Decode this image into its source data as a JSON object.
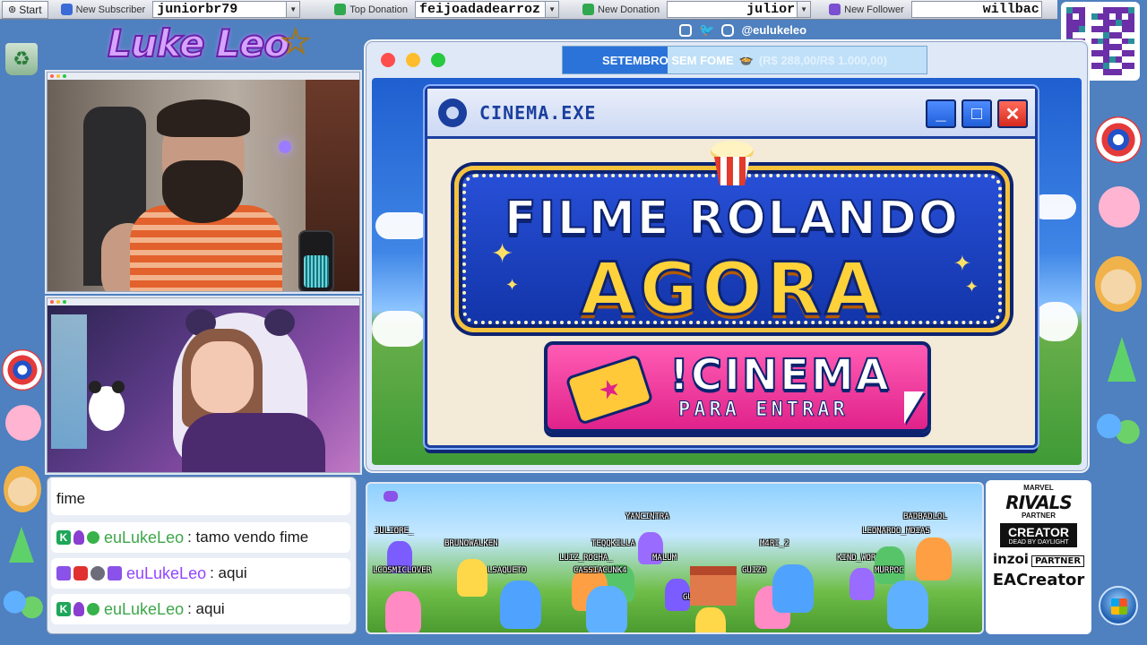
{
  "taskbar": {
    "start_label": "Start",
    "sections": [
      {
        "label": "New Subscriber",
        "value": "juniorbr79",
        "color": "#3a6bd6"
      },
      {
        "label": "Top Donation",
        "value": "feijoadadearroz",
        "color": "#2fa84f"
      },
      {
        "label": "New Donation",
        "value": "julior",
        "color": "#2fa84f"
      },
      {
        "label": "New Follower",
        "value": "willbac",
        "color": "#7a4fd1"
      }
    ]
  },
  "logo": {
    "text": "Luke Leo"
  },
  "social": {
    "handle": "@eulukeleo"
  },
  "donation_goal": {
    "campaign": "SETEMBRO SEM FOME",
    "goal_text": "(R$ 288,00/R$ 1.000,00)",
    "progress_fraction": 0.288
  },
  "cinema_window": {
    "title": "CINEMA.EXE",
    "minimize": "_",
    "maximize": "□",
    "close": "✕",
    "headline_line1": "FILME ROLANDO",
    "headline_line2": "AGORA",
    "command": "!CINEMA",
    "command_sub": "PARA ENTRAR"
  },
  "chat": {
    "messages": [
      {
        "user": "",
        "text": "fime",
        "badges": []
      },
      {
        "user": "euLukeLeo",
        "text": ": tamo vendo fime",
        "badges": [
          "k",
          "m",
          "v"
        ],
        "platform": "kick"
      },
      {
        "user": "euLukeLeo",
        "text": ": aqui",
        "badges": [
          "tw",
          "yt",
          "cat",
          "tw"
        ],
        "platform": "twitch"
      },
      {
        "user": "euLukeLeo",
        "text": ": aqui",
        "badges": [
          "k",
          "m",
          "v"
        ],
        "platform": "kick"
      }
    ]
  },
  "game_names": [
    "JULIORE_",
    "BRUNOWALKEN",
    "LCOSMICLOVER",
    "LSAQUETO",
    "YANCINTRA",
    "TEQQKILLA",
    "LUIZ_ROCHA_",
    "CASSIACUNK4",
    "MALUM",
    "GURBSMP",
    "GUIZO",
    "M4RI_2",
    "KIND_WORM",
    "LEONARDO_MDIAS",
    "BADBADLOL",
    "MURPOC"
  ],
  "partners": {
    "rivals": "RIVALS",
    "rivals_top": "MARVEL",
    "rivals_sub": "PARTNER",
    "creator": "CREATOR",
    "creator_sub": "DEAD BY DAYLIGHT",
    "inzoi": "inzoi",
    "inzoi_sub": "PARTNER",
    "ea": "EACreator"
  },
  "colors": {
    "desktop": "#4f80bf",
    "cinema_blue": "#1b3f9e",
    "marquee_gold": "#ffd23a",
    "cta_pink": "#e0228a",
    "kick_green": "#3da64a",
    "twitch_purple": "#9146ff"
  }
}
